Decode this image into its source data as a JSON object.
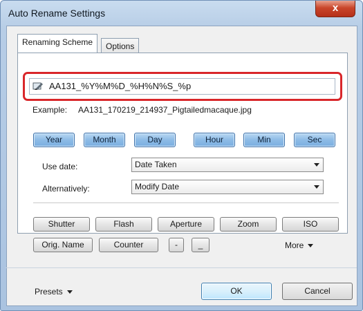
{
  "window": {
    "title": "Auto Rename Settings",
    "close_glyph": "x",
    "close_icon": "close-icon"
  },
  "tabs": [
    {
      "label": "Renaming Scheme",
      "active": true
    },
    {
      "label": "Options",
      "active": false
    }
  ],
  "scheme": {
    "value": "AA131_%Y%M%D_%H%N%S_%p",
    "icon": "pencil-icon",
    "highlight_color": "#d9262a"
  },
  "example": {
    "label": "Example:",
    "value": "AA131_170219_214937_Pigtailedmacaque.jpg"
  },
  "date_tokens": [
    "Year",
    "Month",
    "Day",
    "Hour",
    "Min",
    "Sec"
  ],
  "use_date": {
    "label": "Use date:",
    "value": "Date Taken"
  },
  "alternatively": {
    "label": "Alternatively:",
    "value": "Modify Date"
  },
  "exif_tokens": [
    "Shutter",
    "Flash",
    "Aperture",
    "Zoom",
    "ISO"
  ],
  "misc_tokens": [
    "Orig. Name",
    "Counter",
    "-",
    "_"
  ],
  "more_label": "More",
  "footer": {
    "presets_label": "Presets",
    "ok_label": "OK",
    "cancel_label": "Cancel"
  },
  "colors": {
    "token_blue": "#8dbbe6",
    "title_bar": "#b7cde6",
    "close_red": "#c9462b"
  }
}
